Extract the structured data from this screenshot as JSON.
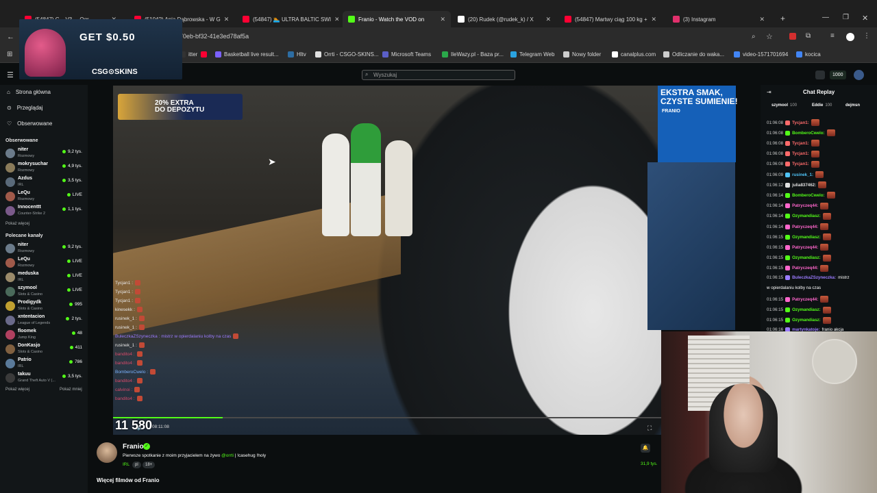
{
  "browser": {
    "tabs": [
      {
        "label": "(54847) C... V3 ... Ogr...",
        "color": "#ff0033"
      },
      {
        "label": "(5104?) Anja Dąbrowska - W G",
        "color": "#ff0033"
      },
      {
        "label": "(54847) 🏊 ULTRA BALTIC SWI",
        "color": "#ff0033"
      },
      {
        "label": "Franio - Watch the VOD on",
        "color": "#53fc18",
        "active": true
      },
      {
        "label": "(20) Rudek (@rudek_k) / X",
        "color": "#ffffff"
      },
      {
        "label": "(54847) Martwy ciąg 100 kg + ",
        "color": "#ff0033"
      },
      {
        "label": "(3) Instagram",
        "color": "#e1306c"
      }
    ],
    "new_tab": "+",
    "url_fragment": "70eb-bf32-41e3ed78af5a",
    "bookmarks": [
      {
        "label": "itter",
        "color": "#333333"
      },
      {
        "label": "",
        "color": "#ff0033"
      },
      {
        "label": "Basketball live result...",
        "color": "#7b61ff"
      },
      {
        "label": "Hltv",
        "color": "#2d6da3"
      },
      {
        "label": "Orrti - CSGO-SKINS...",
        "color": "#e0e0e0"
      },
      {
        "label": "Microsoft Teams",
        "color": "#5b5fc7"
      },
      {
        "label": "IleWazy.pl - Baza pr...",
        "color": "#2aa84a"
      },
      {
        "label": "Telegram Web",
        "color": "#2aa3e0"
      },
      {
        "label": "Nowy folder",
        "color": "#cccccc"
      },
      {
        "label": "canalplus.com",
        "color": "#ffffff"
      },
      {
        "label": "Odliczanie do waka...",
        "color": "#cccccc"
      },
      {
        "label": "video-1571701694",
        "color": "#4285f4"
      },
      {
        "label": "kocica",
        "color": "#4285f4"
      }
    ]
  },
  "ad": {
    "headline": "GET $0.50",
    "brand": "CSG⊙SKINS"
  },
  "site": {
    "search_placeholder": "Wyszukaj",
    "coins": "1000",
    "accent": "#53fc18"
  },
  "sidebar": {
    "nav": [
      {
        "label": "Strona główna",
        "icon": "home-icon"
      },
      {
        "label": "Przeglądaj",
        "icon": "browse-icon"
      },
      {
        "label": "Obserwowane",
        "icon": "heart-icon"
      }
    ],
    "followed_title": "Obserwowane",
    "followed": [
      {
        "name": "niter",
        "category": "Rozmowy",
        "viewers": "9,2 tys.",
        "color": "#6b7b8a"
      },
      {
        "name": "mokrysuchar",
        "category": "Rozmowy",
        "viewers": "4,9 tys.",
        "color": "#8a7b5a"
      },
      {
        "name": "Azdus",
        "category": "IRL",
        "viewers": "3,5 tys.",
        "color": "#5a6a7a"
      },
      {
        "name": "LeQu",
        "category": "Rozmowy",
        "viewers": "LIVE",
        "color": "#a05a4a"
      },
      {
        "name": "Innocenttt",
        "category": "Counter-Strike 2",
        "viewers": "1,1 tys.",
        "color": "#7a5a8a"
      }
    ],
    "show_more_1": "Pokaż więcej",
    "recommended_title": "Polecane kanały",
    "recommended": [
      {
        "name": "niter",
        "category": "Rozmowy",
        "viewers": "9,2 tys.",
        "color": "#6b7b8a"
      },
      {
        "name": "LeQu",
        "category": "Rozmowy",
        "viewers": "LIVE",
        "color": "#a05a4a"
      },
      {
        "name": "meduska",
        "category": "IRL",
        "viewers": "LIVE",
        "color": "#9a8a6a"
      },
      {
        "name": "szymool",
        "category": "Slots & Casino",
        "viewers": "LIVE",
        "color": "#4a6a5a"
      },
      {
        "name": "Prodigydk",
        "category": "Slots & Casino",
        "viewers": "995",
        "color": "#c0a030"
      },
      {
        "name": "xntentacion",
        "category": "League of Legends",
        "viewers": "2 tys.",
        "color": "#6a6a8a"
      },
      {
        "name": "floomek",
        "category": "Jump King",
        "viewers": "48",
        "color": "#b04060"
      },
      {
        "name": "DonKasjo",
        "category": "Slots & Casino",
        "viewers": "411",
        "color": "#806040"
      },
      {
        "name": "Patrio",
        "category": "IRL",
        "viewers": "786",
        "color": "#5a7a9a"
      },
      {
        "name": "takuu",
        "category": "Grand Theft Auto V (...",
        "viewers": "3,5 tys.",
        "color": "#3a3a3a"
      }
    ],
    "show_more_2": "Pokaż więcej",
    "show_less": "Pokaż mniej"
  },
  "player": {
    "promo_top": "20% EXTRA\nDO DEPOZYTU",
    "promo_right_1": "EKSTRA SMAK,\nCZYSTE SUMIENIE!",
    "promo_right_2": "FRANIO",
    "video_chat": [
      "Tycjan1 :",
      "Tycjan1 :",
      "Tycjan1 :",
      "kinesekk :",
      "rusinek_1 :",
      "rusinek_1 :",
      "BuleczkaZSzyneczka : mistrz w opierdalaniu kolby na czas",
      "rusinek_1 :",
      "bandito4 :",
      "bandito4 :",
      "BomberoCwelo :",
      "bandito4 :",
      "calvinoi :",
      "bandito4 :"
    ],
    "big_count": "11 580",
    "timecode": "08:11:08",
    "progress_fraction": 0.2
  },
  "stream": {
    "streamer": "Franio",
    "title_before": "Pierwsze spotkanie z moim przyjacielem na żywo ",
    "title_mention": "@orrti",
    "title_after": " | !casehug !holy",
    "category": "IRL",
    "tags": [
      "pl",
      "18+"
    ],
    "viewers": "31,9 tys.",
    "more_videos": "Więcej filmów od Franio"
  },
  "chat": {
    "title": "Chat Replay",
    "pinned": [
      {
        "name": "szymool",
        "amount": "100"
      },
      {
        "name": "Eddie",
        "amount": "100"
      },
      {
        "name": "dejmsn",
        "amount": ""
      }
    ],
    "messages": [
      {
        "ts": "01:06:08",
        "user": "Tycjan1:",
        "color": "#ff6b6b",
        "text": ""
      },
      {
        "ts": "01:06:08",
        "user": "BomberoCwelo:",
        "color": "#53fc18",
        "text": ""
      },
      {
        "ts": "01:06:08",
        "user": "Tycjan1:",
        "color": "#ff6b6b",
        "text": ""
      },
      {
        "ts": "01:06:08",
        "user": "Tycjan1:",
        "color": "#ff6b6b",
        "text": ""
      },
      {
        "ts": "01:06:08",
        "user": "Tycjan1:",
        "color": "#ff6b6b",
        "text": ""
      },
      {
        "ts": "01:06:09",
        "user": "rusinek_1:",
        "color": "#4fc3f7",
        "text": ""
      },
      {
        "ts": "01:06:12",
        "user": "julia837462:",
        "color": "#e0e0e0",
        "text": ""
      },
      {
        "ts": "01:06:14",
        "user": "BomberoCwelo:",
        "color": "#53fc18",
        "text": ""
      },
      {
        "ts": "01:06:14",
        "user": "Patryczeq44:",
        "color": "#ff66cc",
        "text": ""
      },
      {
        "ts": "01:06:14",
        "user": "Ozymandiasz:",
        "color": "#53fc18",
        "text": ""
      },
      {
        "ts": "01:06:14",
        "user": "Patryczeq44:",
        "color": "#ff66cc",
        "text": ""
      },
      {
        "ts": "01:06:15",
        "user": "Ozymandiasz:",
        "color": "#53fc18",
        "text": ""
      },
      {
        "ts": "01:06:15",
        "user": "Patryczeq44:",
        "color": "#ff66cc",
        "text": ""
      },
      {
        "ts": "01:06:15",
        "user": "Ozymandiasz:",
        "color": "#53fc18",
        "text": ""
      },
      {
        "ts": "01:06:15",
        "user": "Patryczeq44:",
        "color": "#ff66cc",
        "text": ""
      },
      {
        "ts": "01:06:15",
        "user": "BuleczkaZSzyneczka:",
        "color": "#9b7bff",
        "text": "mistrz"
      },
      {
        "ts": "",
        "user": "",
        "color": "#ffffff",
        "text": "w opierdalaniu kolby na czas"
      },
      {
        "ts": "01:06:15",
        "user": "Patryczeq44:",
        "color": "#ff66cc",
        "text": ""
      },
      {
        "ts": "01:06:15",
        "user": "Ozymandiasz:",
        "color": "#53fc18",
        "text": ""
      },
      {
        "ts": "01:06:15",
        "user": "Ozymandiasz:",
        "color": "#53fc18",
        "text": ""
      },
      {
        "ts": "01:06:16",
        "user": "martynkatoje:",
        "color": "#9b7bff",
        "text": "franio akcja"
      }
    ]
  }
}
